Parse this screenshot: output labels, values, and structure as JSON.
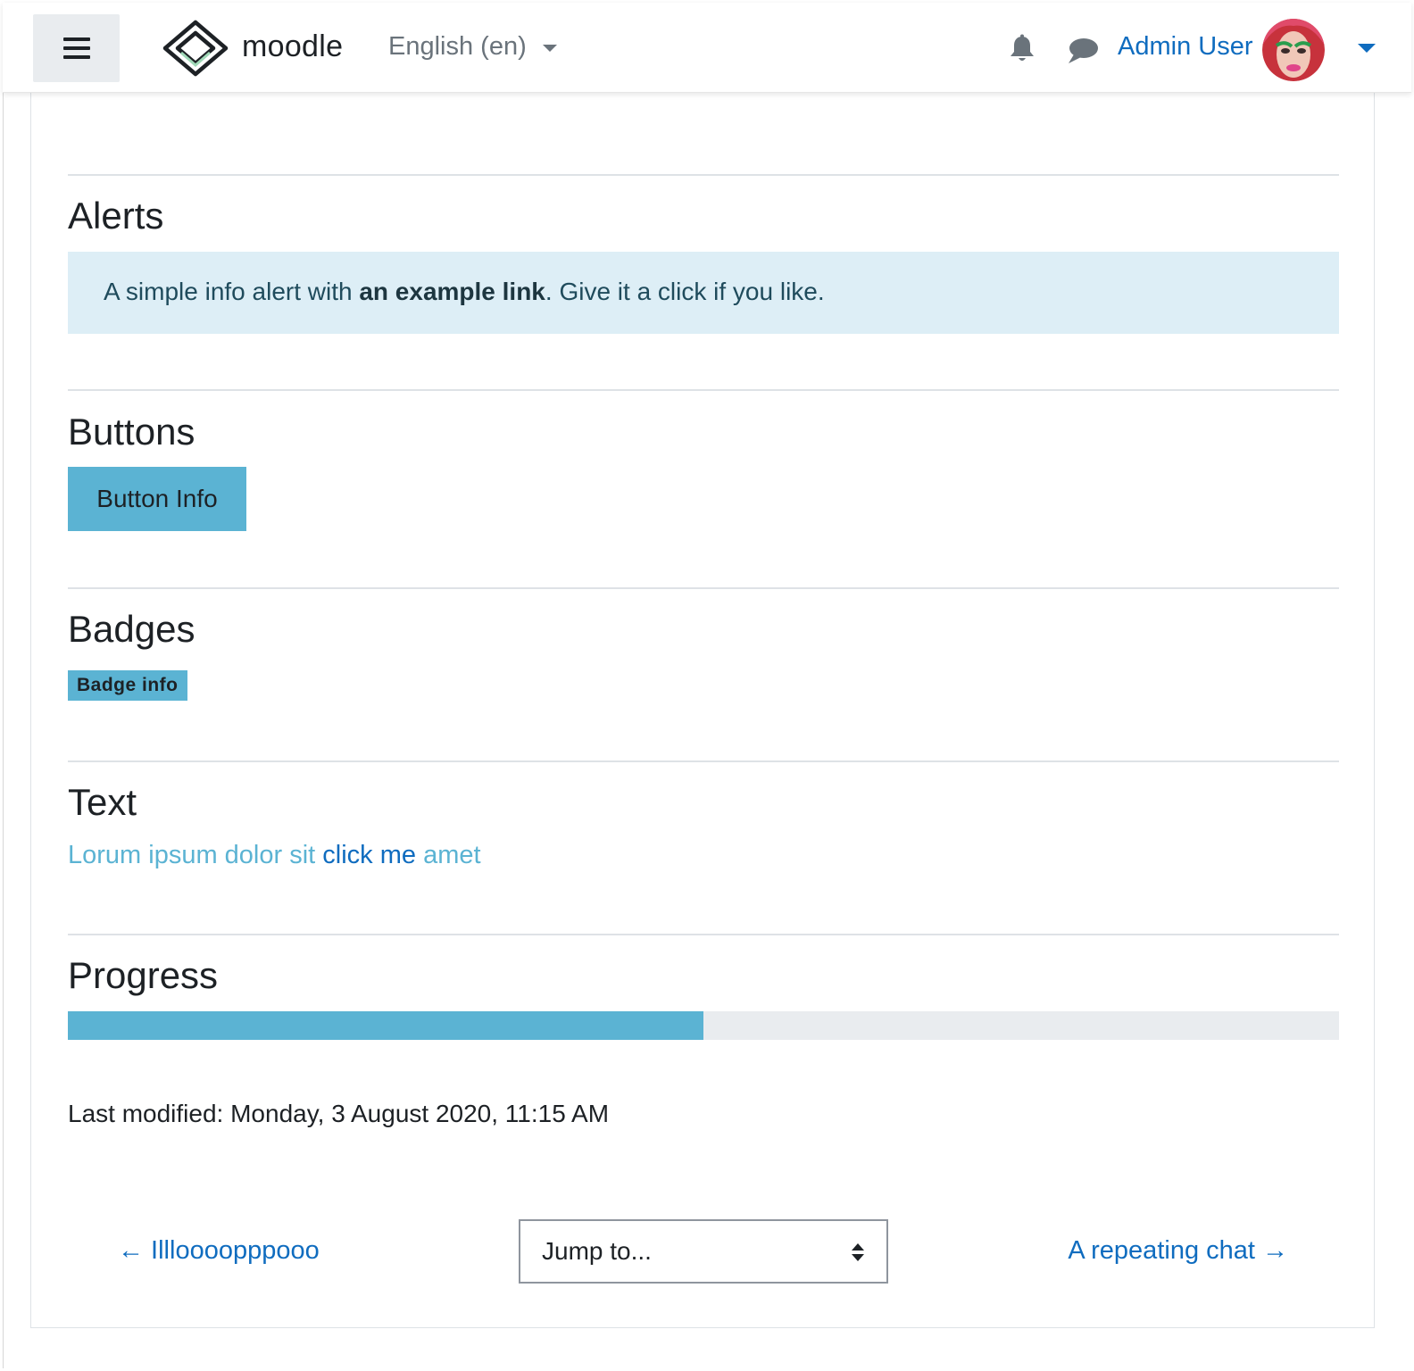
{
  "navbar": {
    "brand": "moodle",
    "language": "English (en)",
    "user_name": "Admin User",
    "icons": [
      "menu-icon",
      "moodle-logo",
      "bell-icon",
      "chat-bubble-icon",
      "chevron-down-icon"
    ]
  },
  "sections": {
    "alerts": {
      "title": "Alerts",
      "text_before": "A simple info alert with ",
      "link": "an example link",
      "text_after": ". Give it a click if you like."
    },
    "buttons": {
      "title": "Buttons",
      "button_label": "Button Info"
    },
    "badges": {
      "title": "Badges",
      "badge_label": "Badge info"
    },
    "text": {
      "title": "Text",
      "before": "Lorum ipsum dolor sit ",
      "link": "click me",
      "after": " amet"
    },
    "progress": {
      "title": "Progress",
      "value_percent": 50
    }
  },
  "footer": {
    "last_modified": "Last modified: Monday, 3 August 2020, 11:15 AM",
    "prev_link": "← Illloooopppooo",
    "jump_placeholder": "Jump to...",
    "next_link": "A repeating chat →"
  },
  "colors": {
    "brand_blue": "#0f6cbf",
    "info": "#5bb3d3",
    "alert_bg": "#ddeef6"
  }
}
